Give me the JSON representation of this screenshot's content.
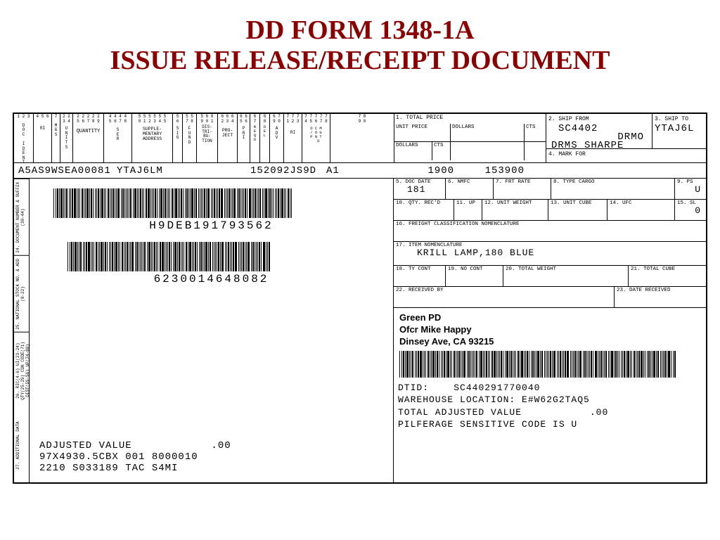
{
  "title_line1": "DD FORM 1348-1A",
  "title_line2": "ISSUE RELEASE/RECEIPT DOCUMENT",
  "header_row": {
    "doc_ident": "A5AS9WS",
    "ea_qty": "EA00081",
    "supp_addr": "YTAJ6LM",
    "proj": "152092JS9D",
    "a1": "A1",
    "n1900": "1900",
    "n153900": "153900"
  },
  "top": {
    "total_price_lbl": "1. TOTAL PRICE",
    "ship_from_lbl": "2. SHIP FROM",
    "ship_from_val1": "SC4402",
    "ship_from_val2": "DRMO",
    "ship_from_val3": "DRMS SHARPE",
    "ship_to_lbl": "3. SHIP TO",
    "ship_to_val": "YTAJ6L",
    "mark_for_lbl": "4. MARK FOR",
    "unit_price_lbl": "UNIT PRICE",
    "dollars_lbl": "DOLLARS",
    "cts_lbl": "CTS"
  },
  "colheads": [
    "1 2 3",
    "4 5 6",
    "7",
    "8",
    "2 2",
    "2 2 2 2 2",
    "4 4 4 4",
    "5 5 5 5 5 5",
    "6 6 6 6 6",
    "6 6",
    "7 7 7",
    "7 7 7 8",
    "8"
  ],
  "collabels": [
    "DOC IDENT",
    "RI",
    "M & S",
    "UNIT ISS",
    "QUANTITY",
    "SER",
    "SUPPLE-\nMENTARY\nADDRESS",
    "SIG",
    "FUND",
    "DIS-\nTRI-\nBU-\nTION",
    "PRO-\nJECT",
    "PRI",
    "REQD DEL",
    "ADV",
    "RI",
    "O/P IND",
    "COND",
    "MGT"
  ],
  "left": {
    "barcode1_label": "H9DEB191793562",
    "barcode2_label": "6230014648082",
    "adj_line": "ADJUSTED VALUE            .00",
    "code_line1": "97X4930.5CBX 001  8000010",
    "code_line2": "2210 S033189 TAC S4MI"
  },
  "side": {
    "s1": "24. DOCUMENT NUMBER & SUFFIX (30-44)",
    "s2": "25. NATIONAL STOCK NO. & ADD (8-22)",
    "s3": "26. RIC(4-6) UI(23-24) QTY(25-29) CON CODE(71) DIST(55-56) UP(74-80)",
    "s4": "27. ADDITIONAL DATA"
  },
  "right": {
    "r5_lbl": "5. DOC DATE",
    "r5_val": "181",
    "r6_lbl": "6. NMFC",
    "r7_lbl": "7. FRT RATE",
    "r8_lbl": "8. TYPE CARGO",
    "r9_lbl": "9. PS",
    "r9_val": "U",
    "r10_lbl": "10. QTY. REC'D",
    "r11_lbl": "11. UP",
    "r12_lbl": "12. UNIT WEIGHT",
    "r13_lbl": "13. UNIT CUBE",
    "r14_lbl": "14. UFC",
    "r15_lbl": "15. SL",
    "r15_val": "0",
    "r16_lbl": "16. FREIGHT CLASSIFICATION NOMENCLATURE",
    "r17_lbl": "17. ITEM NOMENCLATURE",
    "r17_val": "KRILL LAMP,180 BLUE",
    "r18_lbl": "18. TY CONT",
    "r19_lbl": "19. NO CONT",
    "r20_lbl": "20. TOTAL WEIGHT",
    "r21_lbl": "21. TOTAL CUBE",
    "r22_lbl": "22. RECEIVED BY",
    "r23_lbl": "23. DATE RECEIVED",
    "addr_l1": "Green PD",
    "addr_l2": "Ofcr Mike Happy",
    "addr_l3": "Dinsey Ave, CA 93215",
    "dtid_lbl": "DTID:",
    "dtid_val": "SC440291770040",
    "wh_line": "WAREHOUSE LOCATION: E#W62G2TAQ5",
    "tav_line": "TOTAL ADJUSTED VALUE           .00",
    "psc_line": "PILFERAGE SENSITIVE CODE IS U"
  }
}
